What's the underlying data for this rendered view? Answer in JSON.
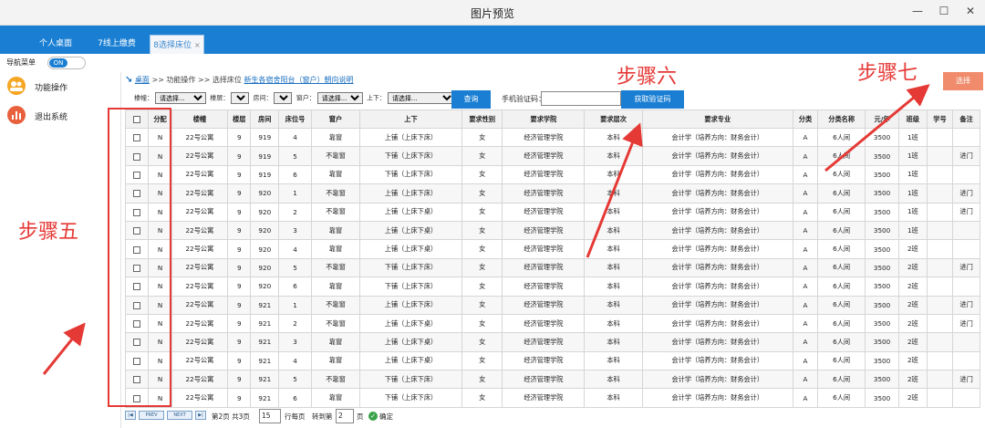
{
  "window": {
    "title": "图片预览"
  },
  "tabs": [
    {
      "label": "个人桌面"
    },
    {
      "label": "7线上缴费"
    },
    {
      "label": "8选择床位",
      "close": "×"
    }
  ],
  "nav": {
    "label": "导航菜单",
    "toggle": "ON"
  },
  "sidebar": {
    "items": [
      {
        "label": "功能操作",
        "icon": "gear-people-icon",
        "color": "#f5a623"
      },
      {
        "label": "退出系统",
        "icon": "chart-icon",
        "color": "#e8603c"
      }
    ]
  },
  "breadcrumb": {
    "home": "桌面",
    "path": ">> 功能操作 >> 选择床位",
    "title": "新生各宿舍阳台（窗户）朝向说明"
  },
  "filters": {
    "building_label": "楼幢：",
    "building_value": "请选择...",
    "floor_label": "楼层：",
    "floor_value": "",
    "room_label": "房间：",
    "room_value": "",
    "window_label": "窗户：",
    "window_value": "请选择...",
    "bed_label": "上下：",
    "bed_value": "请选择..."
  },
  "buttons": {
    "query": "查询",
    "get_code": "获取验证码",
    "select": "选择"
  },
  "phone": {
    "label": "手机验证码：",
    "value": ""
  },
  "columns": [
    "",
    "分配",
    "楼幢",
    "楼层",
    "房间",
    "床位号",
    "窗户",
    "上下",
    "要求性别",
    "要求学院",
    "要求层次",
    "要求专业",
    "分类",
    "分类名称",
    "元/年",
    "班级",
    "学号",
    "备注"
  ],
  "rows": [
    [
      "N",
      "22号公寓",
      "9",
      "919",
      "4",
      "靠窗",
      "上铺（上床下床）",
      "女",
      "经济管理学院",
      "本科",
      "会计学（培养方向：财务会计）",
      "A",
      "6人间",
      "3500",
      "1班",
      "",
      ""
    ],
    [
      "N",
      "22号公寓",
      "9",
      "919",
      "5",
      "不靠窗",
      "下铺（上床下床）",
      "女",
      "经济管理学院",
      "本科",
      "会计学（培养方向：财务会计）",
      "A",
      "6人间",
      "3500",
      "1班",
      "",
      "进门"
    ],
    [
      "N",
      "22号公寓",
      "9",
      "919",
      "6",
      "靠窗",
      "下铺（上床下床）",
      "女",
      "经济管理学院",
      "本科",
      "会计学（培养方向：财务会计）",
      "A",
      "6人间",
      "3500",
      "1班",
      "",
      ""
    ],
    [
      "N",
      "22号公寓",
      "9",
      "920",
      "1",
      "不靠窗",
      "上铺（上床下床）",
      "女",
      "经济管理学院",
      "本科",
      "会计学（培养方向：财务会计）",
      "A",
      "6人间",
      "3500",
      "1班",
      "",
      "进门"
    ],
    [
      "N",
      "22号公寓",
      "9",
      "920",
      "2",
      "不靠窗",
      "上铺（上床下桌）",
      "女",
      "经济管理学院",
      "本科",
      "会计学（培养方向：财务会计）",
      "A",
      "6人间",
      "3500",
      "1班",
      "",
      "进门"
    ],
    [
      "N",
      "22号公寓",
      "9",
      "920",
      "3",
      "靠窗",
      "上铺（上床下桌）",
      "女",
      "经济管理学院",
      "本科",
      "会计学（培养方向：财务会计）",
      "A",
      "6人间",
      "3500",
      "1班",
      "",
      ""
    ],
    [
      "N",
      "22号公寓",
      "9",
      "920",
      "4",
      "靠窗",
      "上铺（上床下桌）",
      "女",
      "经济管理学院",
      "本科",
      "会计学（培养方向：财务会计）",
      "A",
      "6人间",
      "3500",
      "2班",
      "",
      ""
    ],
    [
      "N",
      "22号公寓",
      "9",
      "920",
      "5",
      "不靠窗",
      "下铺（上床下床）",
      "女",
      "经济管理学院",
      "本科",
      "会计学（培养方向：财务会计）",
      "A",
      "6人间",
      "3500",
      "2班",
      "",
      "进门"
    ],
    [
      "N",
      "22号公寓",
      "9",
      "920",
      "6",
      "靠窗",
      "下铺（上床下床）",
      "女",
      "经济管理学院",
      "本科",
      "会计学（培养方向：财务会计）",
      "A",
      "6人间",
      "3500",
      "2班",
      "",
      ""
    ],
    [
      "N",
      "22号公寓",
      "9",
      "921",
      "1",
      "不靠窗",
      "上铺（上床下床）",
      "女",
      "经济管理学院",
      "本科",
      "会计学（培养方向：财务会计）",
      "A",
      "6人间",
      "3500",
      "2班",
      "",
      "进门"
    ],
    [
      "N",
      "22号公寓",
      "9",
      "921",
      "2",
      "不靠窗",
      "上铺（上床下桌）",
      "女",
      "经济管理学院",
      "本科",
      "会计学（培养方向：财务会计）",
      "A",
      "6人间",
      "3500",
      "2班",
      "",
      "进门"
    ],
    [
      "N",
      "22号公寓",
      "9",
      "921",
      "3",
      "靠窗",
      "上铺（上床下桌）",
      "女",
      "经济管理学院",
      "本科",
      "会计学（培养方向：财务会计）",
      "A",
      "6人间",
      "3500",
      "2班",
      "",
      ""
    ],
    [
      "N",
      "22号公寓",
      "9",
      "921",
      "4",
      "靠窗",
      "上铺（上床下桌）",
      "女",
      "经济管理学院",
      "本科",
      "会计学（培养方向：财务会计）",
      "A",
      "6人间",
      "3500",
      "2班",
      "",
      ""
    ],
    [
      "N",
      "22号公寓",
      "9",
      "921",
      "5",
      "不靠窗",
      "下铺（上床下床）",
      "女",
      "经济管理学院",
      "本科",
      "会计学（培养方向：财务会计）",
      "A",
      "6人间",
      "3500",
      "2班",
      "",
      "进门"
    ],
    [
      "N",
      "22号公寓",
      "9",
      "921",
      "6",
      "靠窗",
      "下铺（上床下床）",
      "女",
      "经济管理学院",
      "本科",
      "会计学（培养方向：财务会计）",
      "A",
      "6人间",
      "3500",
      "2班",
      "",
      ""
    ]
  ],
  "pager": {
    "prev": "PREV",
    "next": "NEXT",
    "page_text": "第2页 共3页",
    "page_size": "15",
    "per_page_label": "行每页",
    "goto_label": "转到第",
    "goto_value": "2",
    "page_unit": "页",
    "confirm": "确定"
  },
  "annotations": {
    "step5": "步骤五",
    "step6": "步骤六",
    "step7": "步骤七",
    "color": "#e53935"
  }
}
